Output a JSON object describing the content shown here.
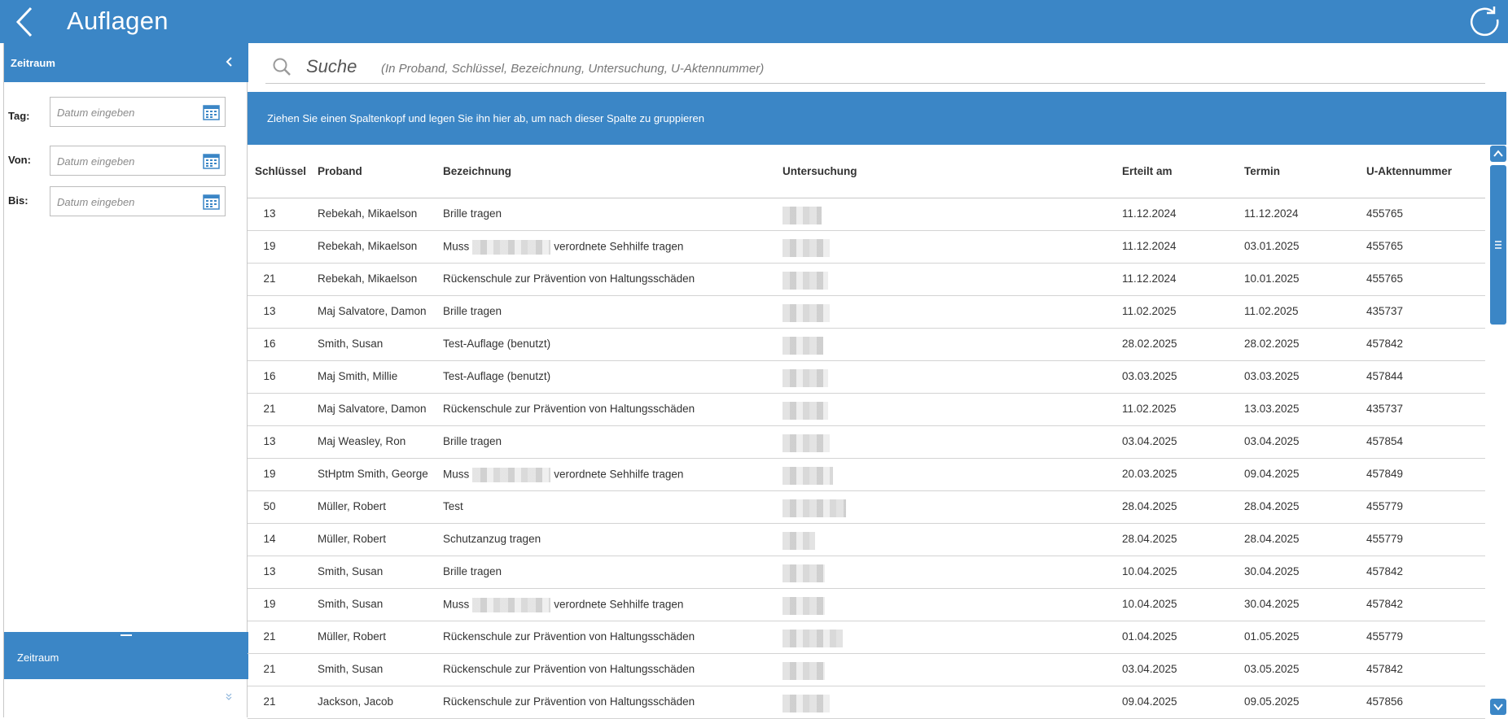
{
  "app": {
    "title": "Auflagen"
  },
  "sidebar": {
    "header": "Zeitraum",
    "fields": [
      {
        "label": "Tag:",
        "placeholder": "Datum eingeben",
        "value": ""
      },
      {
        "label": "Von:",
        "placeholder": "Datum eingeben",
        "value": ""
      },
      {
        "label": "Bis:",
        "placeholder": "Datum eingeben",
        "value": ""
      }
    ],
    "bottom_panel": "Zeitraum"
  },
  "search": {
    "label": "Suche",
    "hint": "(In Proband, Schlüssel, Bezeichnung, Untersuchung, U-Aktennummer)"
  },
  "grouping": {
    "text": "Ziehen Sie einen Spaltenkopf und legen Sie ihn hier ab, um nach dieser Spalte zu gruppieren"
  },
  "table": {
    "columns": [
      "Schlüssel",
      "Proband",
      "Bezeichnung",
      "Untersuchung",
      "Erteilt am",
      "Termin",
      "U-Aktennummer"
    ],
    "rows": [
      {
        "key": "13",
        "proband": "Rebekah, Mikaelson",
        "desc": "Brille tragen",
        "erteilt": "11.12.2024",
        "termin": "11.12.2024",
        "akte": "455765"
      },
      {
        "key": "19",
        "proband": "Rebekah, Mikaelson",
        "desc_pre": "Muss",
        "desc_post": "verordnete Sehhilfe tragen",
        "erteilt": "11.12.2024",
        "termin": "03.01.2025",
        "akte": "455765"
      },
      {
        "key": "21",
        "proband": "Rebekah, Mikaelson",
        "desc": "Rückenschule zur Prävention von Haltungsschäden",
        "erteilt": "11.12.2024",
        "termin": "10.01.2025",
        "akte": "455765"
      },
      {
        "key": "13",
        "proband": "Maj Salvatore, Damon",
        "desc": "Brille tragen",
        "erteilt": "11.02.2025",
        "termin": "11.02.2025",
        "akte": "435737"
      },
      {
        "key": "16",
        "proband": "Smith, Susan",
        "desc": "Test-Auflage (benutzt)",
        "erteilt": "28.02.2025",
        "termin": "28.02.2025",
        "akte": "457842"
      },
      {
        "key": "16",
        "proband": "Maj Smith, Millie",
        "desc": "Test-Auflage (benutzt)",
        "erteilt": "03.03.2025",
        "termin": "03.03.2025",
        "akte": "457844"
      },
      {
        "key": "21",
        "proband": "Maj Salvatore, Damon",
        "desc": "Rückenschule zur Prävention von Haltungsschäden",
        "erteilt": "11.02.2025",
        "termin": "13.03.2025",
        "akte": "435737"
      },
      {
        "key": "13",
        "proband": "Maj Weasley, Ron",
        "desc": "Brille tragen",
        "erteilt": "03.04.2025",
        "termin": "03.04.2025",
        "akte": "457854"
      },
      {
        "key": "19",
        "proband": "StHptm Smith, George",
        "desc_pre": "Muss",
        "desc_post": "verordnete Sehhilfe tragen",
        "erteilt": "20.03.2025",
        "termin": "09.04.2025",
        "akte": "457849"
      },
      {
        "key": "50",
        "proband": "Müller, Robert",
        "desc": "Test",
        "erteilt": "28.04.2025",
        "termin": "28.04.2025",
        "akte": "455779"
      },
      {
        "key": "14",
        "proband": "Müller, Robert",
        "desc": "Schutzanzug tragen",
        "erteilt": "28.04.2025",
        "termin": "28.04.2025",
        "akte": "455779"
      },
      {
        "key": "13",
        "proband": "Smith, Susan",
        "desc": "Brille tragen",
        "erteilt": "10.04.2025",
        "termin": "30.04.2025",
        "akte": "457842"
      },
      {
        "key": "19",
        "proband": "Smith, Susan",
        "desc_pre": "Muss",
        "desc_post": "verordnete Sehhilfe tragen",
        "erteilt": "10.04.2025",
        "termin": "30.04.2025",
        "akte": "457842"
      },
      {
        "key": "21",
        "proband": "Müller, Robert",
        "desc": "Rückenschule zur Prävention von Haltungsschäden",
        "erteilt": "01.04.2025",
        "termin": "01.05.2025",
        "akte": "455779"
      },
      {
        "key": "21",
        "proband": "Smith, Susan",
        "desc": "Rückenschule zur Prävention von Haltungsschäden",
        "erteilt": "03.04.2025",
        "termin": "03.05.2025",
        "akte": "457842"
      },
      {
        "key": "21",
        "proband": "Jackson, Jacob",
        "desc": "Rückenschule zur Prävention von Haltungsschäden",
        "erteilt": "09.04.2025",
        "termin": "09.05.2025",
        "akte": "457856"
      }
    ]
  },
  "icons": {
    "back": "back-arrow-icon",
    "refresh": "refresh-icon",
    "collapse": "chevron-left-icon",
    "calendar": "calendar-icon",
    "search": "search-icon",
    "expand": "double-chevron-down-icon",
    "scroll_up": "chevron-up-icon",
    "scroll_down": "chevron-down-icon"
  },
  "colors": {
    "accent": "#3b86c6"
  }
}
